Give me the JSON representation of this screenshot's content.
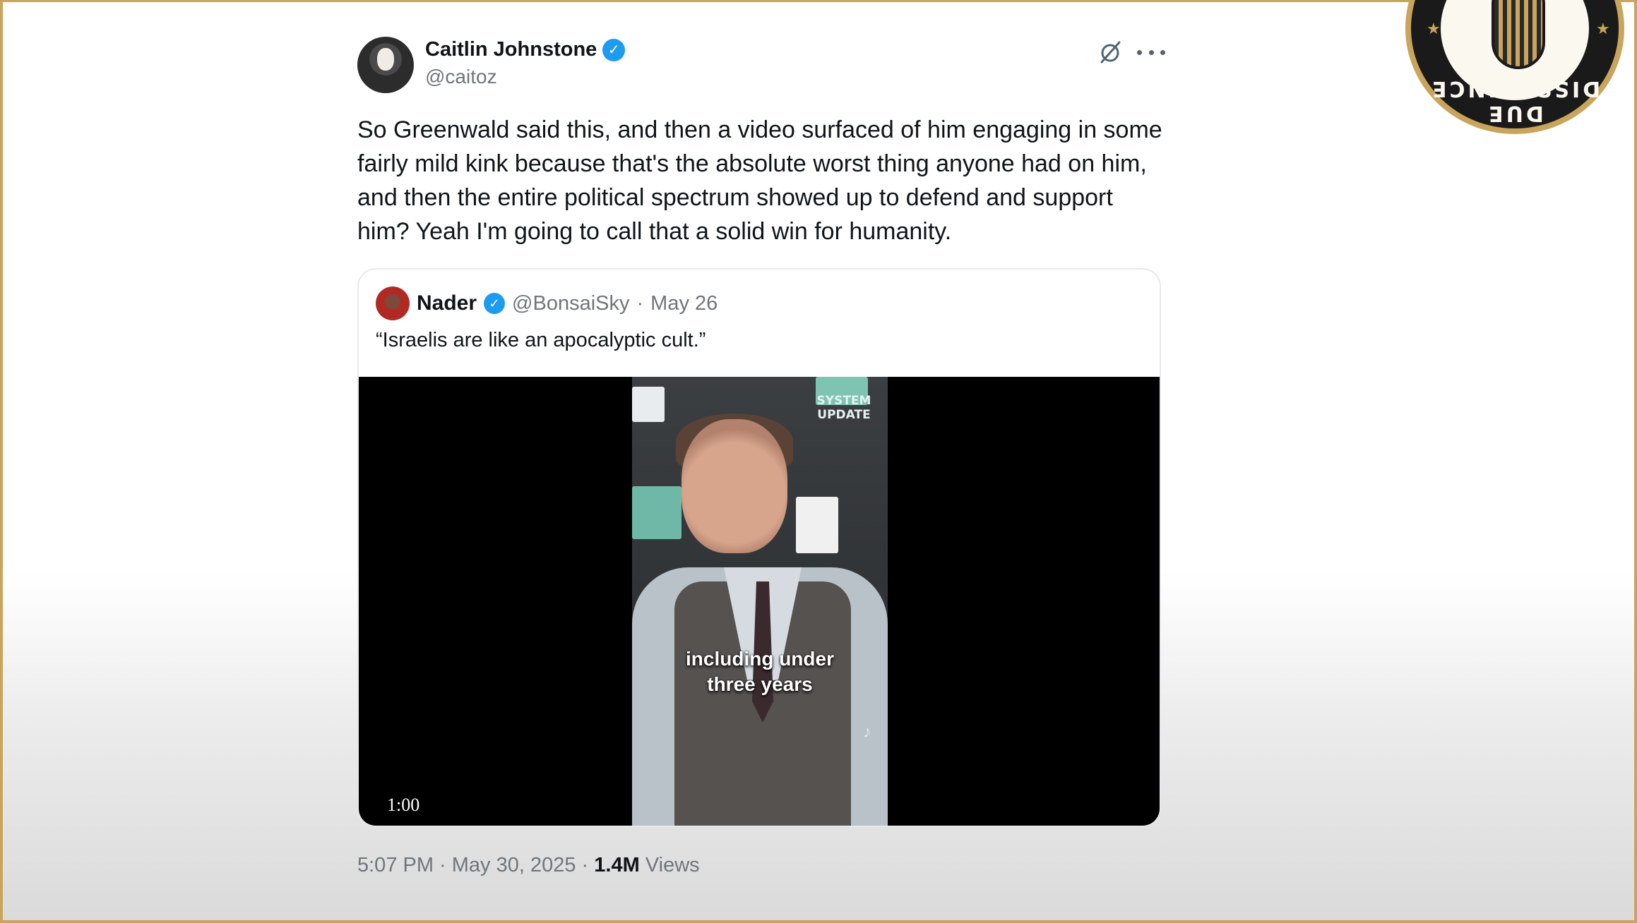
{
  "tweet": {
    "author_name": "Caitlin Johnstone",
    "author_handle": "@caitoz",
    "text": "So Greenwald said this, and then a video surfaced of him engaging in some fairly mild kink because that's the absolute worst thing anyone had on him, and then the entire political spectrum showed up to defend and support him? Yeah I'm going to call that a solid win for humanity.",
    "icons": {
      "grok": "grok-icon",
      "more": "more-options-icon",
      "verified": "verified-badge-icon"
    },
    "timestamp": "5:07 PM · May 30, 2025 · ",
    "views_count": "1.4M",
    "views_label": " Views"
  },
  "quote": {
    "author_name": "Nader",
    "author_handle": "@BonsaiSky",
    "date": "May 26",
    "text": "“Israelis are like an apocalyptic cult.”",
    "video": {
      "caption_line1": "including under",
      "caption_line2": "three years",
      "badge_line1": "SYSTEM",
      "badge_line2": "UPDATE",
      "duration": "1:00",
      "tiktok_icon": "tiktok-icon"
    }
  },
  "logo": {
    "text": "DUE DISSIDENCE"
  },
  "colors": {
    "accent": "#1d9bf0",
    "frame": "#c9a45c",
    "muted_text": "#6f767b"
  }
}
